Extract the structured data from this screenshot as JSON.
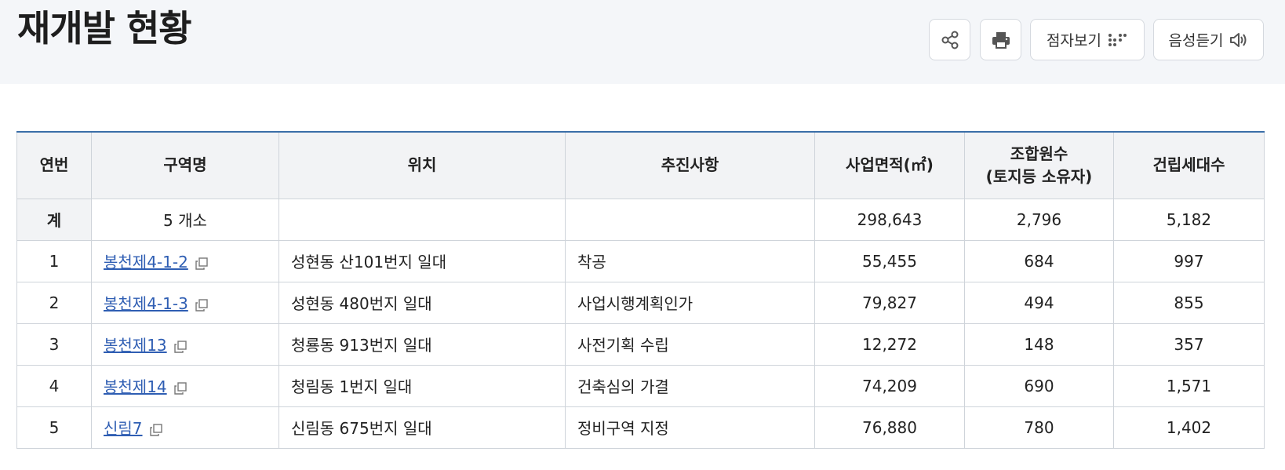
{
  "header": {
    "title": "재개발 현황",
    "tools": {
      "share_icon": "share-icon",
      "print_icon": "printer-icon",
      "braille_label": "점자보기",
      "braille_icon": "braille-dots-icon",
      "voice_label": "음성듣기",
      "voice_icon": "speaker-icon"
    }
  },
  "table": {
    "columns": [
      "연번",
      "구역명",
      "위치",
      "추진사항",
      "사업면적(㎡)",
      "조합원수",
      "(토지등 소유자)",
      "건립세대수"
    ],
    "total": {
      "label": "계",
      "count": "5 개소",
      "location": "",
      "status": "",
      "area": "298,643",
      "members": "2,796",
      "households": "5,182"
    },
    "rows": [
      {
        "no": "1",
        "name": "봉천제4-1-2",
        "location": "성현동 산101번지 일대",
        "status": "착공",
        "area": "55,455",
        "members": "684",
        "households": "997"
      },
      {
        "no": "2",
        "name": "봉천제4-1-3",
        "location": "성현동 480번지 일대",
        "status": "사업시행계획인가",
        "area": "79,827",
        "members": "494",
        "households": "855"
      },
      {
        "no": "3",
        "name": "봉천제13",
        "location": "청룡동 913번지 일대",
        "status": "사전기획 수립",
        "area": "12,272",
        "members": "148",
        "households": "357"
      },
      {
        "no": "4",
        "name": "봉천제14",
        "location": "청림동 1번지 일대",
        "status": "건축심의 가결",
        "area": "74,209",
        "members": "690",
        "households": "1,571"
      },
      {
        "no": "5",
        "name": "신림7",
        "location": "신림동 675번지 일대",
        "status": "정비구역 지정",
        "area": "76,880",
        "members": "780",
        "households": "1,402"
      }
    ]
  },
  "colors": {
    "header_bg": "#f4f6f9",
    "table_top_border": "#3a6ea8",
    "link": "#2f5eb3",
    "th_bg": "#f2f3f5"
  }
}
